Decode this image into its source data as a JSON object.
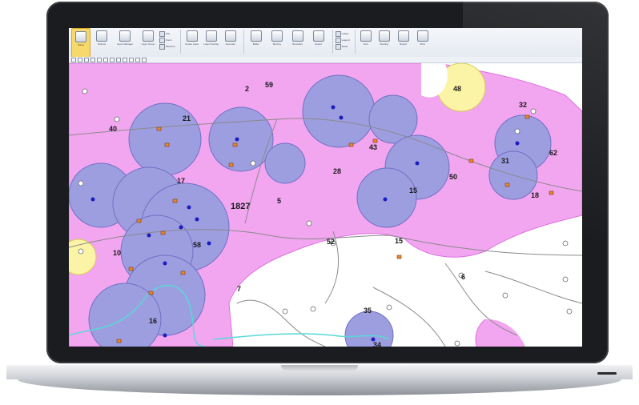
{
  "ribbon": {
    "buttons": [
      {
        "label": "Select",
        "active": true
      },
      {
        "label": "Options"
      },
      {
        "label": "Layer Manager"
      },
      {
        "label": "Layer Group"
      }
    ],
    "small_items": [
      "Pan",
      "Zoom",
      "Measure"
    ],
    "buttons2": [
      {
        "label": "Create Layer"
      },
      {
        "label": "Layer Overlay"
      },
      {
        "label": "Geocode"
      }
    ],
    "buttons3": [
      {
        "label": "Buffer"
      },
      {
        "label": "Territory"
      },
      {
        "label": "Boundary"
      },
      {
        "label": "Export"
      }
    ],
    "small_items2": [
      "Labels",
      "Legend",
      "Scale"
    ],
    "buttons4": [
      {
        "label": "Find"
      },
      {
        "label": "Routing"
      },
      {
        "label": "Report"
      },
      {
        "label": "Print"
      }
    ]
  },
  "map": {
    "colors": {
      "background": "#ffffff",
      "pink_buffer": "#f2a6f0",
      "pink_edge": "#e070e0",
      "blue_buffer": "#9d9ee0",
      "blue_edge": "#6f70c4",
      "yellow_buffer": "#fbf4a6",
      "road": "#8a8a8a",
      "river": "#58d8d6",
      "point_dark": "#1d1cc0",
      "point_orange": "#e6862e"
    },
    "labels": [
      "1827",
      "43",
      "18",
      "52",
      "34",
      "15",
      "5",
      "2",
      "59",
      "40",
      "16",
      "35",
      "21",
      "7",
      "32",
      "15",
      "50",
      "48",
      "31",
      "58",
      "62",
      "6",
      "28",
      "17",
      "10"
    ]
  }
}
